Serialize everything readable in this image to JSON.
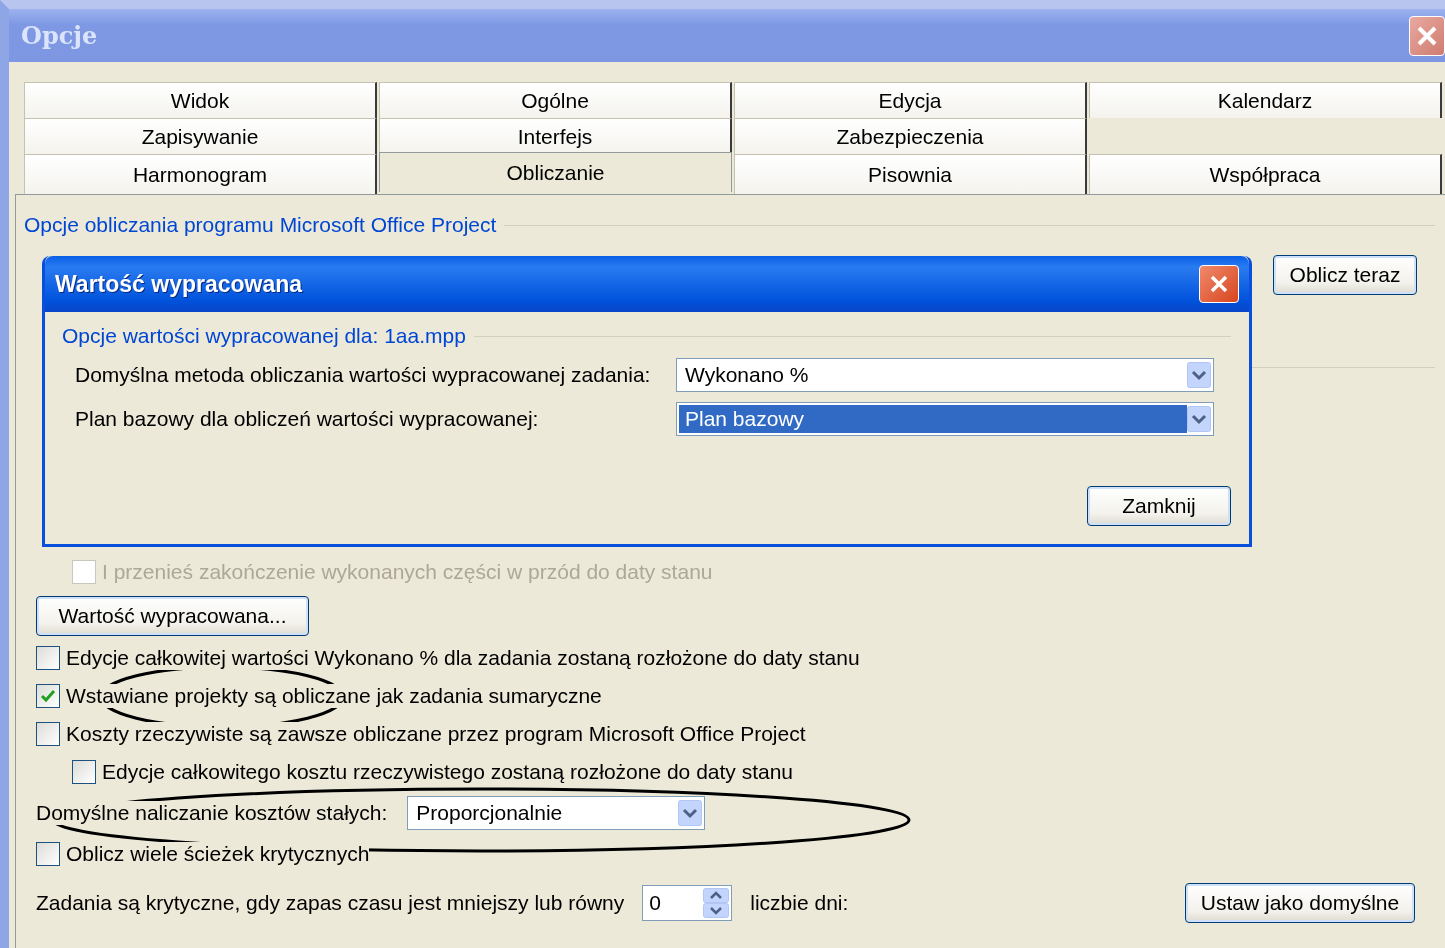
{
  "window": {
    "title": "Opcje"
  },
  "tab_rows": [
    {
      "tabs": [
        {
          "label": "Widok",
          "selected": false
        },
        {
          "label": "Ogólne",
          "selected": false
        },
        {
          "label": "Edycja",
          "selected": false
        },
        {
          "label": "Kalendarz",
          "selected": false
        }
      ]
    },
    {
      "tabs": [
        {
          "label": "Zapisywanie",
          "selected": false
        },
        {
          "label": "Interfejs",
          "selected": false
        },
        {
          "label": "Zabezpieczenia",
          "selected": false
        }
      ]
    },
    {
      "tabs": [
        {
          "label": "Harmonogram",
          "selected": false
        },
        {
          "label": "Obliczanie",
          "selected": true
        },
        {
          "label": "Pisownia",
          "selected": false
        },
        {
          "label": "Współpraca",
          "selected": false
        }
      ]
    }
  ],
  "panel": {
    "group_title": "Opcje obliczania programu Microsoft Office Project",
    "calculate_button": "Oblicz teraz",
    "options": [
      {
        "kind": "subcheckbox",
        "label": "I przenieś zakończenie wykonanych części w przód do daty stanu",
        "checked": false,
        "disabled": true
      },
      {
        "kind": "button",
        "label": "Wartość wypracowana..."
      },
      {
        "kind": "checkbox",
        "label": "Edycje całkowitej wartości Wykonano % dla zadania zostaną rozłożone do daty stanu",
        "checked": false,
        "disabled": false
      },
      {
        "kind": "checkbox",
        "label": "Wstawiane projekty są obliczane jak zadania sumaryczne",
        "checked": true,
        "disabled": false
      },
      {
        "kind": "checkbox",
        "label": "Koszty rzeczywiste są zawsze obliczane przez program Microsoft Office Project",
        "checked": false,
        "disabled": false,
        "children": [
          {
            "kind": "checkbox",
            "label": "Edycje całkowitego kosztu rzeczywistego zostaną rozłożone do daty stanu",
            "checked": false,
            "disabled": false
          }
        ]
      },
      {
        "kind": "select",
        "label": "Domyślne naliczanie kosztów stałych:",
        "value": "Proporcjonalnie"
      },
      {
        "kind": "checkbox",
        "label": "Oblicz wiele ścieżek krytycznych",
        "checked": false,
        "disabled": false
      },
      {
        "kind": "spin",
        "label": "Zadania są krytyczne, gdy zapas czasu jest mniejszy lub równy",
        "value": "0",
        "unit": "liczbie dni:"
      }
    ],
    "default_button": "Ustaw jako domyślne"
  },
  "dialog": {
    "title": "Wartość wypracowana",
    "group_title": "Opcje wartości wypracowanej dla: 1aa.mpp",
    "fields": [
      {
        "label": "Domyślna metoda obliczania wartości wypracowanej zadania:",
        "value": "Wykonano %",
        "selected": false
      },
      {
        "label": "Plan bazowy dla obliczeń wartości wypracowanej:",
        "value": "Plan bazowy",
        "selected": true
      }
    ],
    "close_button": "Zamknij"
  }
}
